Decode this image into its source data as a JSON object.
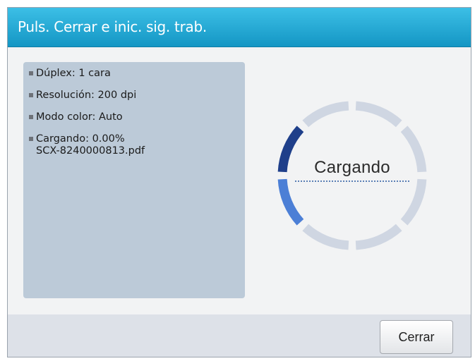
{
  "dialog": {
    "title": "Puls. Cerrar e inic. sig. trab."
  },
  "info": {
    "items": [
      {
        "line1": "Dúplex: 1 cara",
        "line2": ""
      },
      {
        "line1": "Resolución: 200 dpi",
        "line2": ""
      },
      {
        "line1": "Modo color: Auto",
        "line2": ""
      },
      {
        "line1": "Cargando: 0.00%",
        "line2": "SCX-8240000813.pdf"
      }
    ]
  },
  "spinner": {
    "label": "Cargando",
    "icon": "loading-spinner-icon",
    "segment_colors": {
      "inactive": "#cfd6e2",
      "dark": "#1f3f8a",
      "medium": "#4c7fd6"
    }
  },
  "footer": {
    "close_label": "Cerrar"
  }
}
